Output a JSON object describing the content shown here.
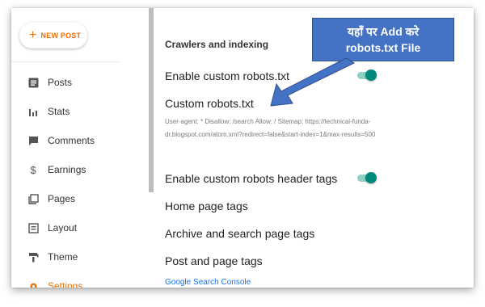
{
  "sidebar": {
    "new_post_label": "NEW POST",
    "items": [
      {
        "label": "Posts",
        "icon": "posts-icon"
      },
      {
        "label": "Stats",
        "icon": "stats-icon"
      },
      {
        "label": "Comments",
        "icon": "comments-icon"
      },
      {
        "label": "Earnings",
        "icon": "dollar-icon"
      },
      {
        "label": "Pages",
        "icon": "pages-icon"
      },
      {
        "label": "Layout",
        "icon": "layout-icon"
      },
      {
        "label": "Theme",
        "icon": "theme-icon"
      },
      {
        "label": "Settings",
        "icon": "settings-icon"
      }
    ]
  },
  "main": {
    "section_title": "Crawlers and indexing",
    "enable_custom_robots": "Enable custom robots.txt",
    "custom_robots_label": "Custom robots.txt",
    "custom_robots_value": "User-agent: * Disallow: /search Allow: / Sitemap: https://technical-funda-dr.blogspot.com/atom.xml?redirect=false&start-index=1&max-results=500",
    "enable_header_tags": "Enable custom robots header tags",
    "home_page_tags": "Home page tags",
    "archive_tags": "Archive and search page tags",
    "post_page_tags": "Post and page tags",
    "search_console_link": "Google Search Console",
    "robots_toggle_on": true,
    "header_toggle_on": true
  },
  "annotation": {
    "line1": "यहाँ पर Add करे",
    "line2": "robots.txt File"
  },
  "colors": {
    "accent": "#e8710a",
    "toggle": "#00897b",
    "callout": "#4472c4",
    "link": "#1a73e8"
  }
}
